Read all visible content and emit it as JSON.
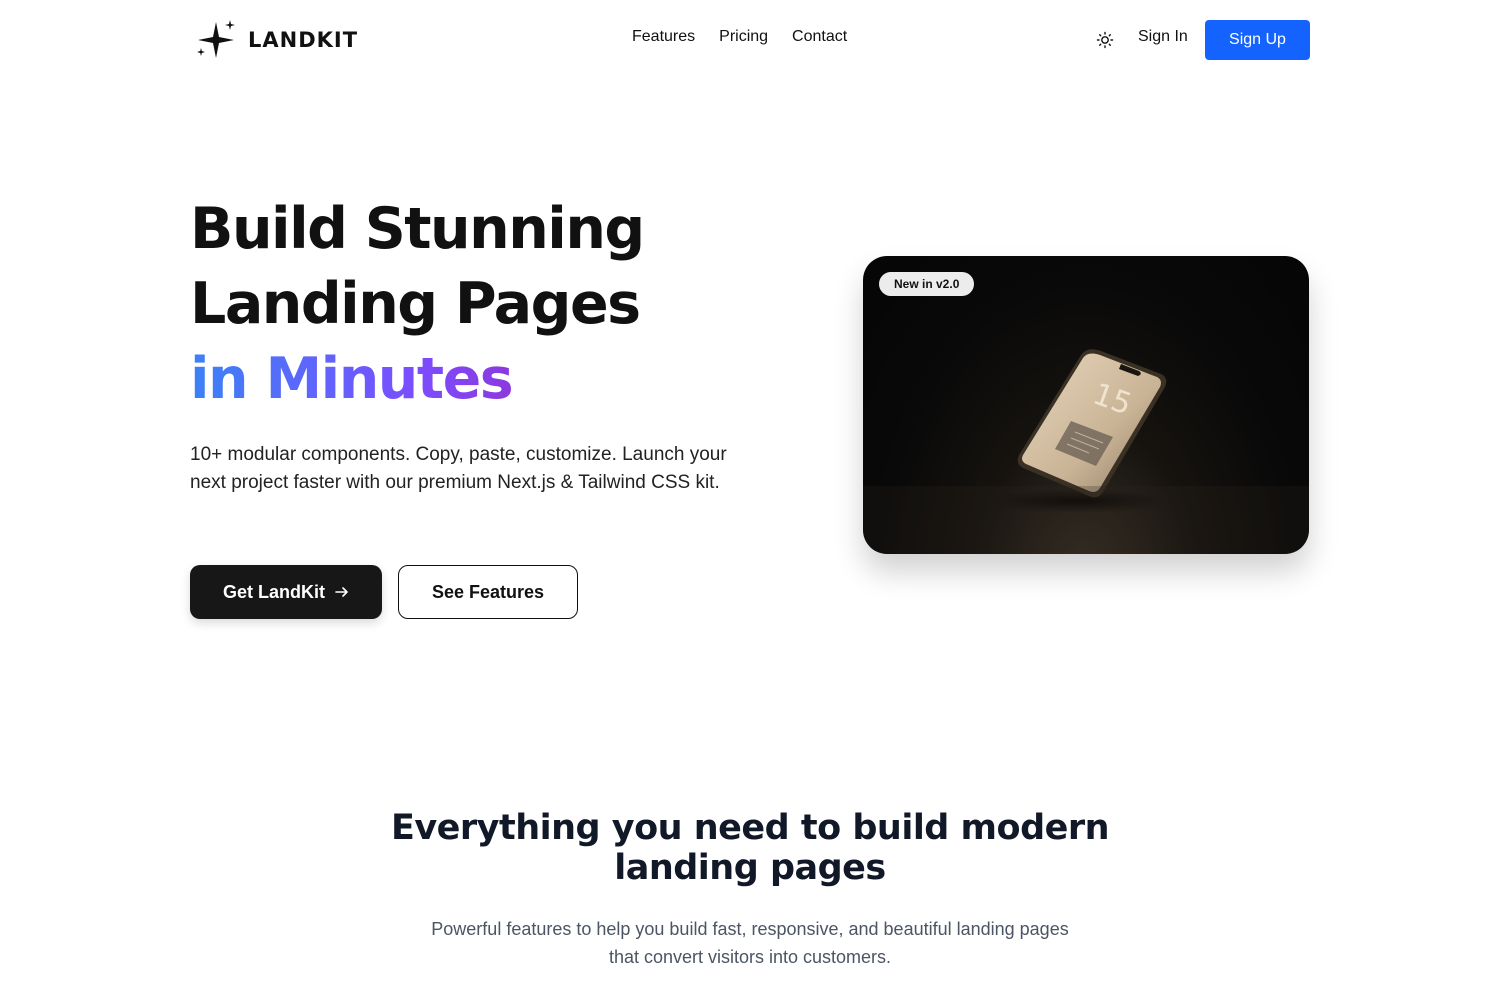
{
  "nav": {
    "logo_text": "LANDKIT",
    "links": [
      "Features",
      "Pricing",
      "Contact"
    ],
    "theme_toggle_icon": "sun-icon",
    "sign_in": "Sign In",
    "sign_up": "Sign Up",
    "accent_color": "#1463ff"
  },
  "hero": {
    "title_line1": "Build Stunning",
    "title_line2": "Landing Pages",
    "title_line3": "in Minutes",
    "subtitle": "10+ modular components. Copy, paste, customize. Launch your next project faster with our premium Next.js & Tailwind CSS kit.",
    "primary_button": "Get LandKit",
    "primary_button_icon": "arrow-right-icon",
    "secondary_button": "See Features",
    "gradient_colors": [
      "#3b82f6",
      "#7c4dff",
      "#a21caf"
    ],
    "image_badge": "New in v2.0",
    "phone_screen_number": "15"
  },
  "features_section": {
    "title_line1": "Everything you need to build modern",
    "title_line2": "landing pages",
    "subtitle_line1": "Powerful features to help you build fast, responsive, and beautiful landing pages",
    "subtitle_line2": "that convert visitors into customers."
  }
}
